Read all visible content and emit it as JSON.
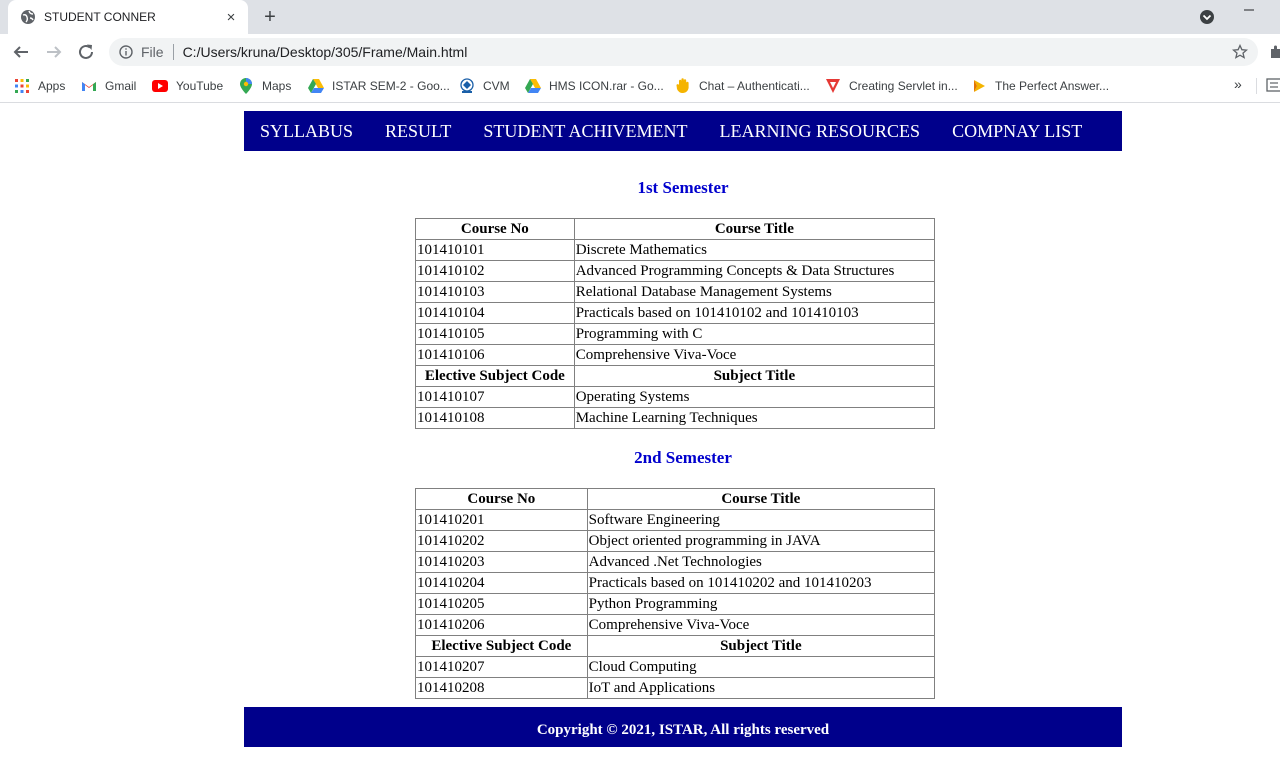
{
  "browser": {
    "tab": {
      "title": "STUDENT CONNER",
      "close_icon": "×"
    },
    "new_tab_icon": "+",
    "omnibox": {
      "scheme_label": "File",
      "url": "C:/Users/kruna/Desktop/305/Frame/Main.html"
    },
    "bookmarks": [
      {
        "label": "Apps",
        "icon": "apps-grid-icon"
      },
      {
        "label": "Gmail",
        "icon": "gmail-icon"
      },
      {
        "label": "YouTube",
        "icon": "youtube-icon"
      },
      {
        "label": "Maps",
        "icon": "maps-pin-icon"
      },
      {
        "label": "ISTAR SEM-2 - Goo...",
        "icon": "google-drive-icon"
      },
      {
        "label": "CVM",
        "icon": "cvm-logo-icon"
      },
      {
        "label": "HMS ICON.rar - Go...",
        "icon": "google-drive-icon"
      },
      {
        "label": "Chat – Authenticati...",
        "icon": "chat-hand-icon"
      },
      {
        "label": "Creating Servlet in...",
        "icon": "javatpoint-icon"
      },
      {
        "label": "The Perfect Answer...",
        "icon": "play-arrow-icon"
      }
    ],
    "more_bookmarks": "»"
  },
  "navbar": {
    "items": [
      "SYLLABUS",
      "RESULT",
      "STUDENT ACHIVEMENT",
      "LEARNING RESOURCES",
      "COMPNAY LIST"
    ]
  },
  "semesters": [
    {
      "title": "1st Semester",
      "headers": [
        "Course No",
        "Course Title"
      ],
      "courses": [
        [
          "101410101",
          "Discrete Mathematics"
        ],
        [
          "101410102",
          "Advanced Programming Concepts & Data Structures"
        ],
        [
          "101410103",
          "Relational Database Management Systems"
        ],
        [
          "101410104",
          "Practicals based on 101410102 and 101410103"
        ],
        [
          "101410105",
          "Programming with C"
        ],
        [
          "101410106",
          "Comprehensive Viva-Voce"
        ]
      ],
      "elective_headers": [
        "Elective Subject Code",
        "Subject Title"
      ],
      "electives": [
        [
          "101410107",
          "Operating Systems"
        ],
        [
          "101410108",
          "Machine Learning Techniques"
        ]
      ]
    },
    {
      "title": "2nd Semester",
      "headers": [
        "Course No",
        "Course Title"
      ],
      "courses": [
        [
          "101410201",
          "Software Engineering"
        ],
        [
          "101410202",
          "Object oriented programming in JAVA"
        ],
        [
          "101410203",
          "Advanced .Net Technologies"
        ],
        [
          "101410204",
          "Practicals based on 101410202 and 101410203"
        ],
        [
          "101410205",
          "Python Programming"
        ],
        [
          "101410206",
          "Comprehensive Viva-Voce"
        ]
      ],
      "elective_headers": [
        "Elective Subject Code",
        "Subject Title"
      ],
      "electives": [
        [
          "101410207",
          "Cloud Computing"
        ],
        [
          "101410208",
          "IoT and Applications"
        ]
      ]
    }
  ],
  "footer": {
    "text": "Copyright © 2021, ISTAR, All rights reserved"
  },
  "colors": {
    "nav_bg": "#00008b",
    "heading": "#0000cd",
    "chrome_bg": "#dee1e6"
  }
}
